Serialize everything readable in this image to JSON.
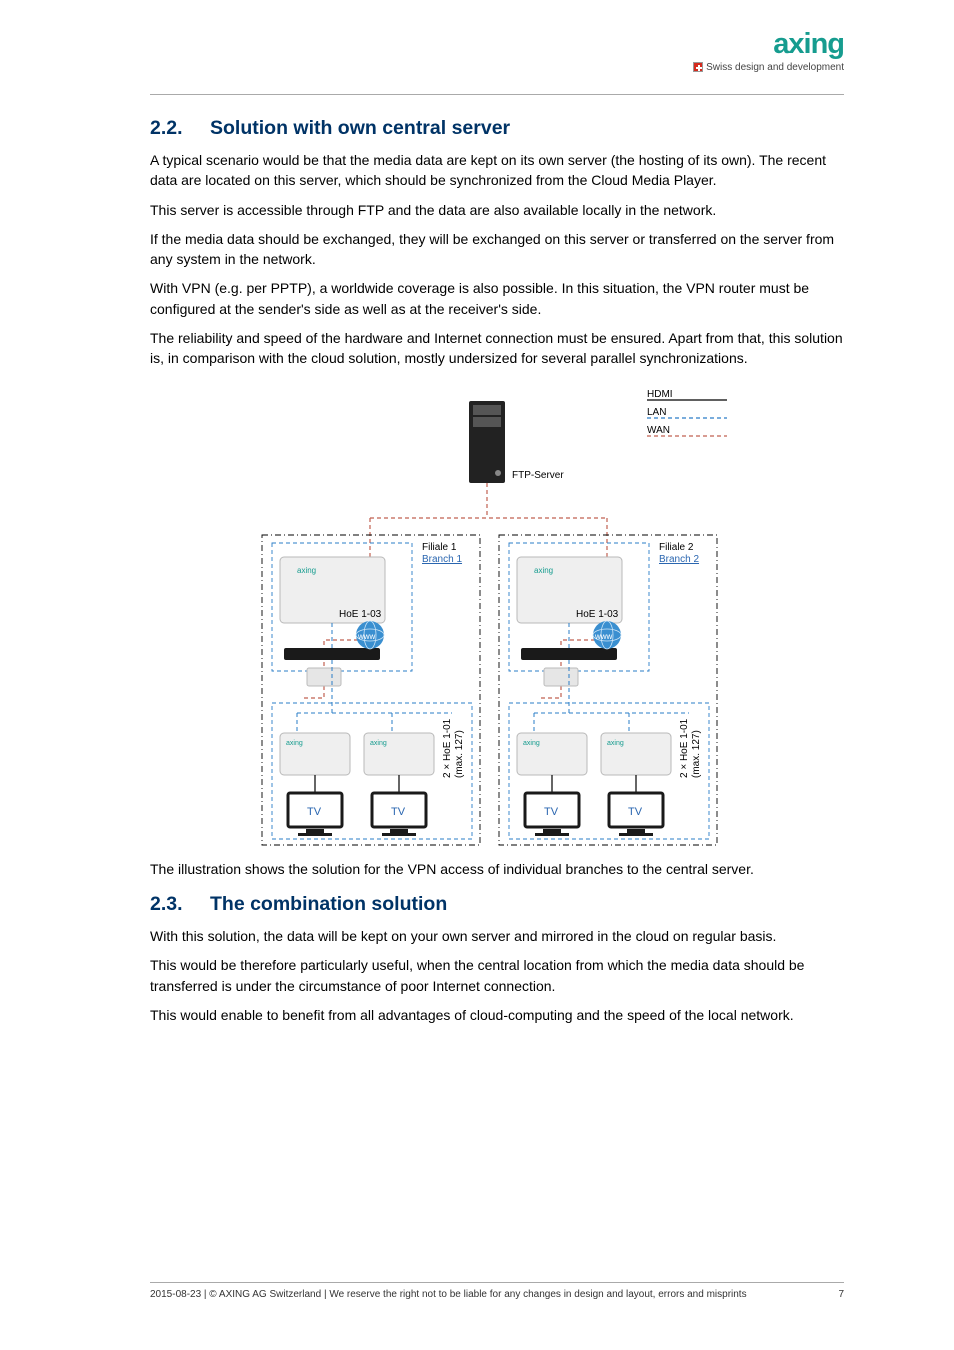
{
  "brand": {
    "name": "axing",
    "tagline": "Swiss design and development"
  },
  "sections": [
    {
      "number": "2.2.",
      "title": "Solution with own central server",
      "paragraphs": [
        "A typical scenario would be that the media data are kept on its own server (the hosting of its own). The recent data are located on this server, which should be synchronized from the Cloud Media Player.",
        "This server is accessible through FTP and the data are also available locally in the network.",
        "If the media data should be exchanged, they will be exchanged on this server or transferred on the server from any system in the network.",
        "With VPN (e.g. per PPTP), a worldwide coverage is also possible. In this situation, the VPN router must be configured at the sender's side as well as at the receiver's side.",
        "The reliability and speed of the hardware and Internet connection must be ensured. Apart from that, this solution is, in comparison with the cloud solution, mostly undersized for several parallel synchronizations."
      ],
      "caption": "The illustration shows the solution for the VPN access of individual branches to the central server."
    },
    {
      "number": "2.3.",
      "title": "The combination solution",
      "paragraphs": [
        "With this solution, the data will be kept on your own server and mirrored in the cloud on regular basis.",
        "This would be therefore particularly useful, when the central location from which the media data should be transferred is under the circumstance of poor Internet connection.",
        "This would enable to benefit from all advantages of cloud-computing and the speed of the local network."
      ]
    }
  ],
  "diagram": {
    "server_label": "FTP-Server",
    "legend": {
      "hdmi": "HDMI",
      "lan": "LAN",
      "wan": "WAN"
    },
    "branches": [
      {
        "title_native": "Filiale 1",
        "title_en": "Branch 1",
        "sender": "HoE 1-03",
        "receiver_line1": "2 × HoE 1-01",
        "receiver_line2": "(max. 127)",
        "tv": "TV",
        "router_brand": "axing",
        "www": "www"
      },
      {
        "title_native": "Filiale 2",
        "title_en": "Branch 2",
        "sender": "HoE 1-03",
        "receiver_line1": "2 × HoE 1-01",
        "receiver_line2": "(max. 127)",
        "tv": "TV",
        "router_brand": "axing",
        "www": "www"
      }
    ]
  },
  "footer": {
    "left": "2015-08-23 | © AXING AG Switzerland | We reserve the right not to be liable for any changes in design and layout, errors and misprints",
    "page": "7"
  },
  "colors": {
    "heading": "#003366",
    "brand": "#169c8f",
    "lan": "#2a7cc7",
    "wan": "#c06050",
    "hdmi": "#000000"
  }
}
